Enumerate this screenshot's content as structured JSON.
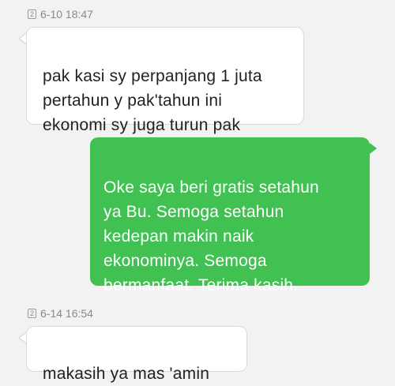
{
  "thread": {
    "sim_label": "2",
    "messages": [
      {
        "timestamp": "6-10 18:47",
        "direction": "incoming",
        "text": "pak kasi sy perpanjang 1 juta\npertahun y pak'tahun ini\nekonomi sy juga turun pak"
      },
      {
        "direction": "outgoing",
        "text": "Oke saya beri gratis setahun\nya Bu. Semoga setahun\nkedepan makin naik\nekonominya. Semoga\nbermanfaat. Terima kasih."
      },
      {
        "timestamp": "6-14 16:54",
        "direction": "incoming",
        "text": "makasih ya mas 'amin"
      }
    ]
  },
  "colors": {
    "background": "#f2f2f2",
    "incoming_bubble": "#ffffff",
    "outgoing_bubble": "#40c152",
    "timestamp_text": "#8a8a8a"
  }
}
